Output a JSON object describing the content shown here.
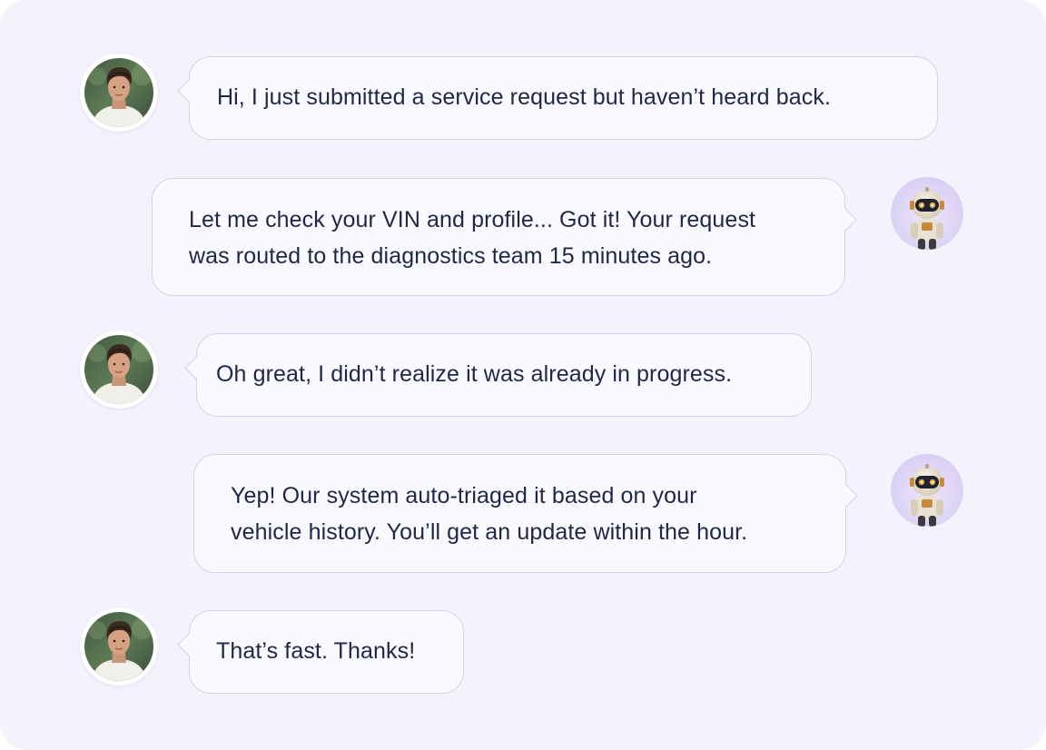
{
  "colors": {
    "panel_background": "#f3f2fd",
    "bubble_background": "#f9f9ff",
    "bubble_border": "#cfd3ee",
    "text": "#1f2746"
  },
  "messages": [
    {
      "sender": "user",
      "avatar_icon": "user-avatar-photo",
      "text": "Hi, I just submitted a service request but haven’t heard back."
    },
    {
      "sender": "assistant",
      "avatar_icon": "robot-avatar",
      "text": "Let me check your VIN and profile... Got it! Your request\nwas routed to the diagnostics team 15 minutes ago."
    },
    {
      "sender": "user",
      "avatar_icon": "user-avatar-photo",
      "text": "Oh great, I didn’t realize it was already in progress."
    },
    {
      "sender": "assistant",
      "avatar_icon": "robot-avatar",
      "text": "Yep! Our system auto-triaged it based on your\nvehicle history. You’ll get an update within the hour."
    },
    {
      "sender": "user",
      "avatar_icon": "user-avatar-photo",
      "text": "That’s fast. Thanks!"
    }
  ]
}
